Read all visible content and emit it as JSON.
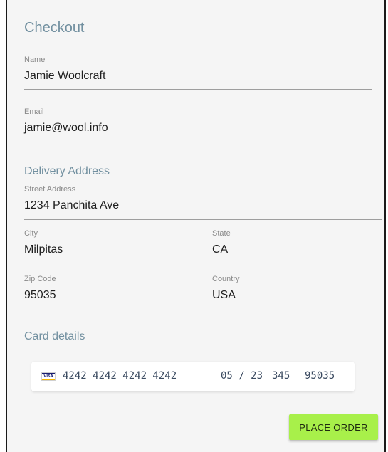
{
  "checkout": {
    "title": "Checkout",
    "name": {
      "label": "Name",
      "value": "Jamie Woolcraft"
    },
    "email": {
      "label": "Email",
      "value": "jamie@wool.info"
    },
    "delivery_heading": "Delivery Address",
    "street": {
      "label": "Street Address",
      "value": "1234 Panchita Ave"
    },
    "city": {
      "label": "City",
      "value": "Milpitas"
    },
    "state": {
      "label": "State",
      "value": "CA"
    },
    "zip": {
      "label": "Zip Code",
      "value": "95035"
    },
    "country": {
      "label": "Country",
      "value": "USA"
    },
    "card_heading": "Card details",
    "card": {
      "brand": "VISA",
      "number": "4242 4242 4242 4242",
      "expiry": "05 / 23",
      "cvc": "345",
      "postal": "95035"
    },
    "place_order_label": "PLACE ORDER"
  },
  "colors": {
    "accent": "#7290a0",
    "button": "#a8f04a",
    "panel": "#f5f5f5"
  }
}
